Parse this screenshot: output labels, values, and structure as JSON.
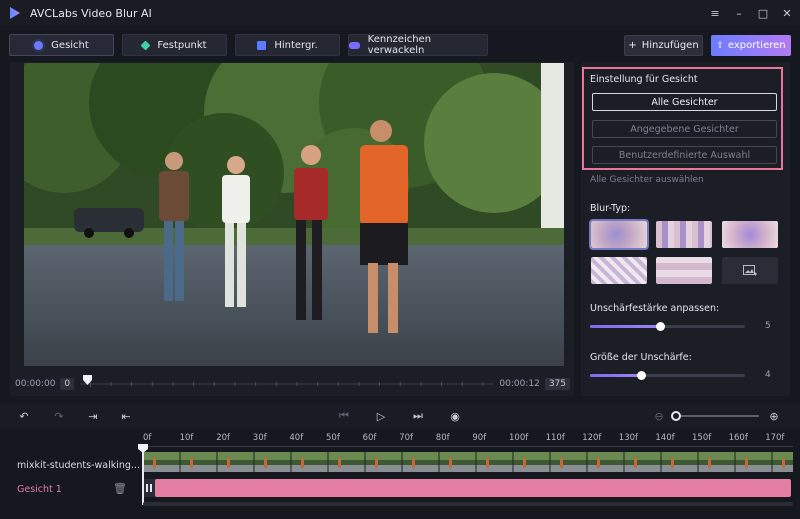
{
  "app": {
    "title": "AVCLabs Video Blur AI"
  },
  "window_controls": [
    "menu-icon",
    "minimize-icon",
    "maximize-icon",
    "close-icon"
  ],
  "tabs": [
    {
      "label": "Gesicht",
      "icon": "face-icon",
      "color": "#6a7bff",
      "active": true
    },
    {
      "label": "Festpunkt",
      "icon": "point-icon",
      "color": "#3fd0a8",
      "active": false
    },
    {
      "label": "Hintergr.",
      "icon": "background-icon",
      "color": "#5a7bff",
      "active": false
    },
    {
      "label": "Kennzeichen verwackeln",
      "icon": "car-icon",
      "color": "#7a6bff",
      "active": false
    }
  ],
  "toolbar": {
    "add_label": "Hinzufügen",
    "add_icon": "+",
    "export_label": "exportieren"
  },
  "preview": {
    "time_start": "00:00:00",
    "frame_start": "0",
    "time_end": "00:00:12",
    "frame_end": "375"
  },
  "settings": {
    "face_title": "Einstellung für Gesicht",
    "options": [
      {
        "label": "Alle Gesichter",
        "selected": true
      },
      {
        "label": "Angegebene Gesichter",
        "selected": false
      },
      {
        "label": "Benutzerdefinierte Auswahl",
        "selected": false
      }
    ],
    "hint": "Alle Gesichter auswählen",
    "blur_type_label": "Blur-Typ:",
    "blur_types": [
      "gaussian-blur",
      "mosaic",
      "pixelate-soft",
      "glass",
      "tile",
      "custom-image-icon"
    ],
    "strength_label": "Unschärfestärke anpassen:",
    "strength_value": "5",
    "strength_level": 0.45,
    "size_label": "Größe der Unschärfe:",
    "size_value": "4",
    "size_level": 0.33
  },
  "timeline": {
    "ruler": [
      "0f",
      "10f",
      "20f",
      "30f",
      "40f",
      "50f",
      "60f",
      "70f",
      "80f",
      "90f",
      "100f",
      "110f",
      "120f",
      "130f",
      "140f",
      "150f",
      "160f",
      "170f"
    ],
    "video_track_label": "mixkit-students-walking...",
    "face_track_label": "Gesicht 1"
  },
  "colors": {
    "accent_pink": "#e47ea3",
    "highlight_border": "#e9759c"
  }
}
